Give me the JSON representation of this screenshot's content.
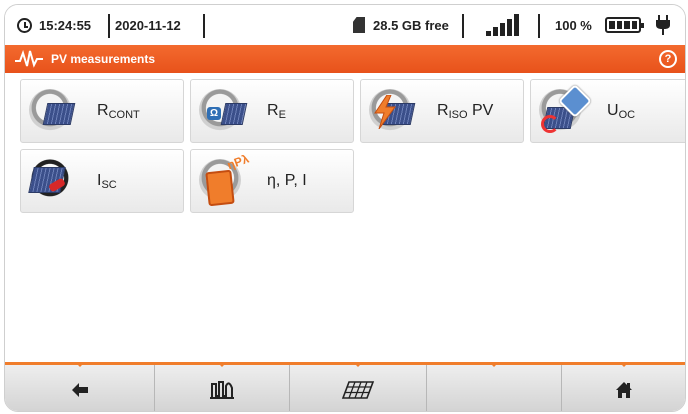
{
  "status": {
    "time": "15:24:55",
    "date": "2020-11-12",
    "storage": "28.5 GB free",
    "battery": "100 %",
    "signal_bars": 5
  },
  "header": {
    "title": "PV measurements",
    "help_icon": "?"
  },
  "tiles": [
    {
      "main": "R",
      "sub": "CONT",
      "suffix": "",
      "icon": "continuity-icon"
    },
    {
      "main": "R",
      "sub": "E",
      "suffix": "",
      "icon": "earth-resistance-icon"
    },
    {
      "main": "R",
      "sub": "ISO",
      "suffix": " PV",
      "icon": "insulation-icon"
    },
    {
      "main": "U",
      "sub": "OC",
      "suffix": "",
      "icon": "open-circuit-voltage-icon"
    },
    {
      "main": "I",
      "sub": "SC",
      "suffix": "",
      "icon": "short-circuit-current-icon"
    },
    {
      "main": "η, P, I",
      "sub": "",
      "suffix": "",
      "icon": "efficiency-icon"
    }
  ],
  "bottom_nav": [
    {
      "icon": "back-arrow-icon"
    },
    {
      "icon": "waveform-icon"
    },
    {
      "icon": "solar-panel-icon"
    },
    {
      "icon": "empty"
    },
    {
      "icon": "home-icon"
    }
  ],
  "colors": {
    "accent": "#e8521b",
    "nav_border": "#f07d2b"
  }
}
